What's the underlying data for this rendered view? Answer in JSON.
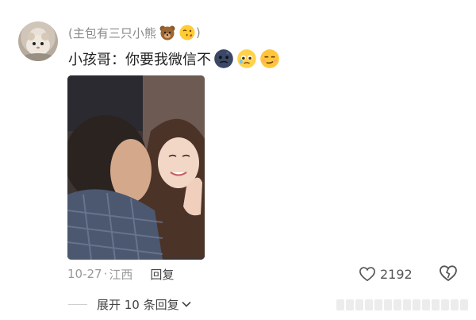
{
  "comment": {
    "author_line": "(主包有三只小熊",
    "author_line_end": ")",
    "author_emojis": [
      "bear-emoji",
      "kiss-emoji"
    ],
    "text": "小孩哥：你要我微信不",
    "text_emojis": [
      "moon-face-emoji",
      "pleading-emoji",
      "smirk-emoji"
    ],
    "date": "10-27",
    "separator": "·",
    "location": "江西",
    "reply_label": "回复",
    "like_count": "2192",
    "expand_label": "展开 10 条回复"
  },
  "colors": {
    "meta_gray": "#9a9a9a",
    "author_gray": "#8a8a8a",
    "text_dark": "#222222"
  }
}
